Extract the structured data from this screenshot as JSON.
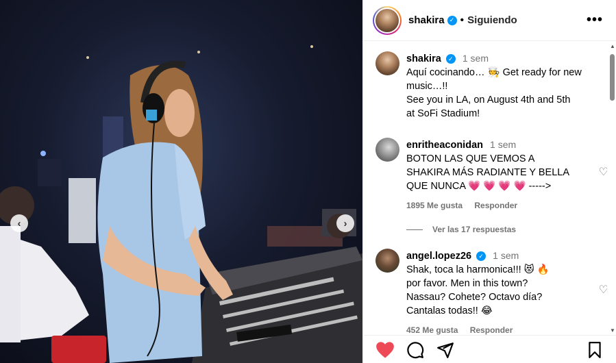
{
  "post": {
    "username": "shakira",
    "follow_status": "Siguiendo",
    "separator": "•"
  },
  "caption": {
    "username": "shakira",
    "time": "1 sem",
    "text_line1": "Aquí cocinando… 🧑‍🍳 Get ready for new",
    "text_line2": "music…!!",
    "text_line3": "See you in LA, on August 4th and 5th",
    "text_line4": "at SoFi Stadium!"
  },
  "comments": [
    {
      "username": "enritheaconidan",
      "time": "1 sem",
      "line1": "BOTON LAS QUE VEMOS A",
      "line2": "SHAKIRA MÁS RADIANTE Y BELLA",
      "line3": "QUE NUNCA ",
      "line3_emoji": "💗 💗 💗 💗",
      "line3_tail": " ----->",
      "likes": "1895 Me gusta",
      "reply": "Responder",
      "view_replies": "Ver las 17 respuestas"
    },
    {
      "username": "angel.lopez26",
      "time": "1 sem",
      "line1": "Shak, toca la harmonica!!! 😻 🔥",
      "line2": "por favor. Men in this town?",
      "line3": "Nassau? Cohete? Octavo día?",
      "line4": "Cantalas todas!! 😂",
      "likes": "452 Me gusta",
      "reply": "Responder"
    }
  ],
  "icons": {
    "like": "heart-filled-icon",
    "comment": "comment-icon",
    "share": "send-icon",
    "save": "bookmark-icon"
  },
  "colors": {
    "like": "#ed4956",
    "verified": "#0095f6",
    "muted": "#737373"
  }
}
